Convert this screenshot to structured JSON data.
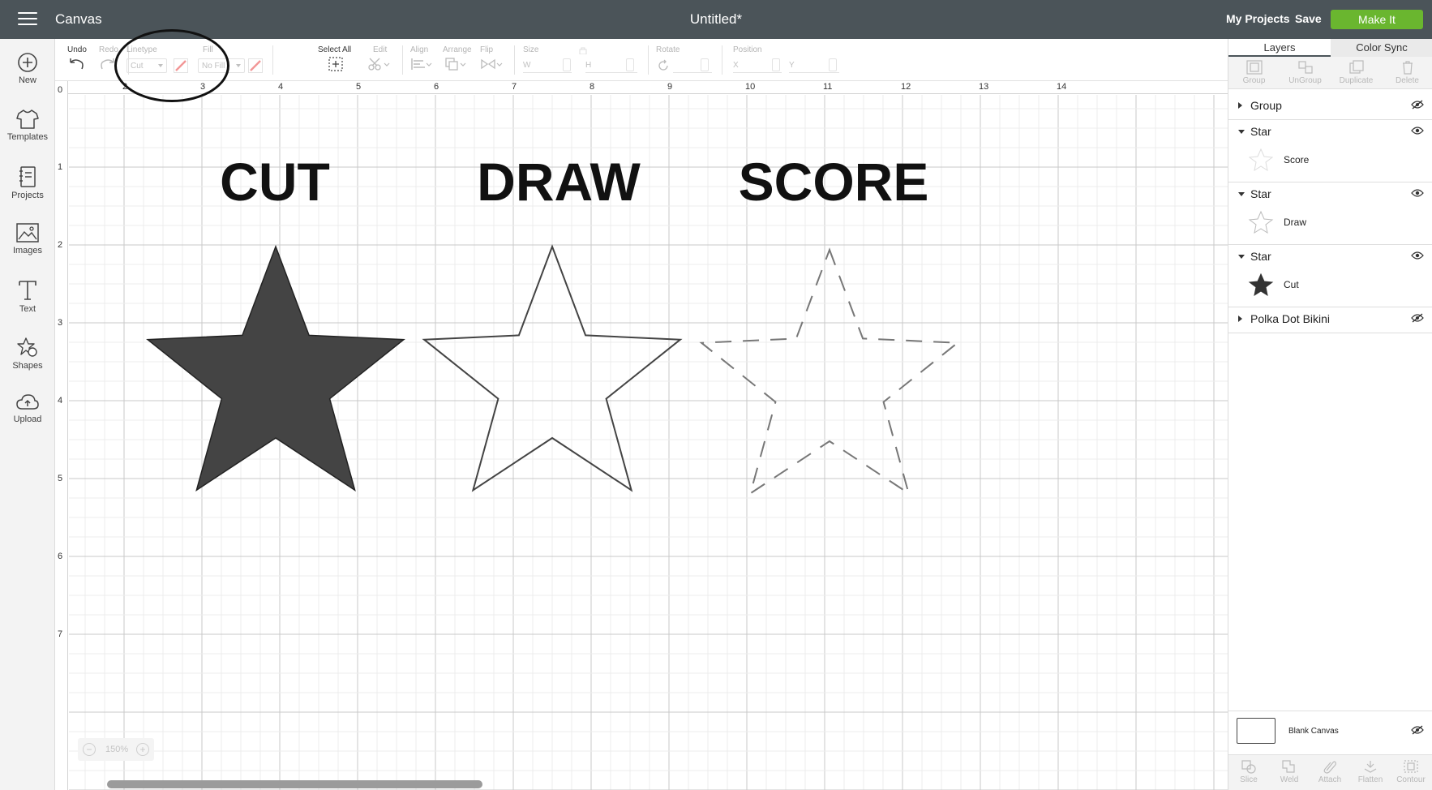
{
  "topbar": {
    "app_title": "Canvas",
    "document_title": "Untitled*",
    "my_projects": "My Projects",
    "save": "Save",
    "make_it": "Make It"
  },
  "sidebar": {
    "items": [
      {
        "label": "New",
        "icon": "plus-circle-icon"
      },
      {
        "label": "Templates",
        "icon": "tshirt-icon"
      },
      {
        "label": "Projects",
        "icon": "notebook-icon"
      },
      {
        "label": "Images",
        "icon": "image-icon"
      },
      {
        "label": "Text",
        "icon": "text-icon"
      },
      {
        "label": "Shapes",
        "icon": "shapes-icon"
      },
      {
        "label": "Upload",
        "icon": "cloud-upload-icon"
      }
    ]
  },
  "toolbar": {
    "undo": "Undo",
    "redo": "Redo",
    "linetype": "Linetype",
    "linetype_value": "Cut",
    "fill": "Fill",
    "fill_value": "No Fill",
    "select_all": "Select All",
    "edit": "Edit",
    "align": "Align",
    "arrange": "Arrange",
    "flip": "Flip",
    "size": "Size",
    "size_w": "W",
    "size_h": "H",
    "rotate": "Rotate",
    "position": "Position",
    "position_x": "X",
    "position_y": "Y"
  },
  "canvas": {
    "ruler_top": [
      "2",
      "3",
      "4",
      "5",
      "6",
      "7",
      "8",
      "9",
      "10",
      "11",
      "12",
      "13",
      "14"
    ],
    "ruler_left": [
      "0",
      "1",
      "2",
      "3",
      "4",
      "5",
      "6",
      "7"
    ],
    "headings": [
      "CUT",
      "DRAW",
      "SCORE"
    ],
    "zoom": "150%",
    "cut_fill_color": "#444444"
  },
  "right_panel": {
    "tabs": [
      "Layers",
      "Color Sync"
    ],
    "actions": [
      "Group",
      "UnGroup",
      "Duplicate",
      "Delete"
    ],
    "layers": {
      "group": "Group",
      "star_score": "Star",
      "star_score_sub": "Score",
      "star_draw": "Star",
      "star_draw_sub": "Draw",
      "star_cut": "Star",
      "star_cut_sub": "Cut",
      "polka": "Polka Dot Bikini"
    },
    "blank_canvas": "Blank Canvas",
    "bottom_actions": [
      "Slice",
      "Weld",
      "Attach",
      "Flatten",
      "Contour"
    ]
  }
}
